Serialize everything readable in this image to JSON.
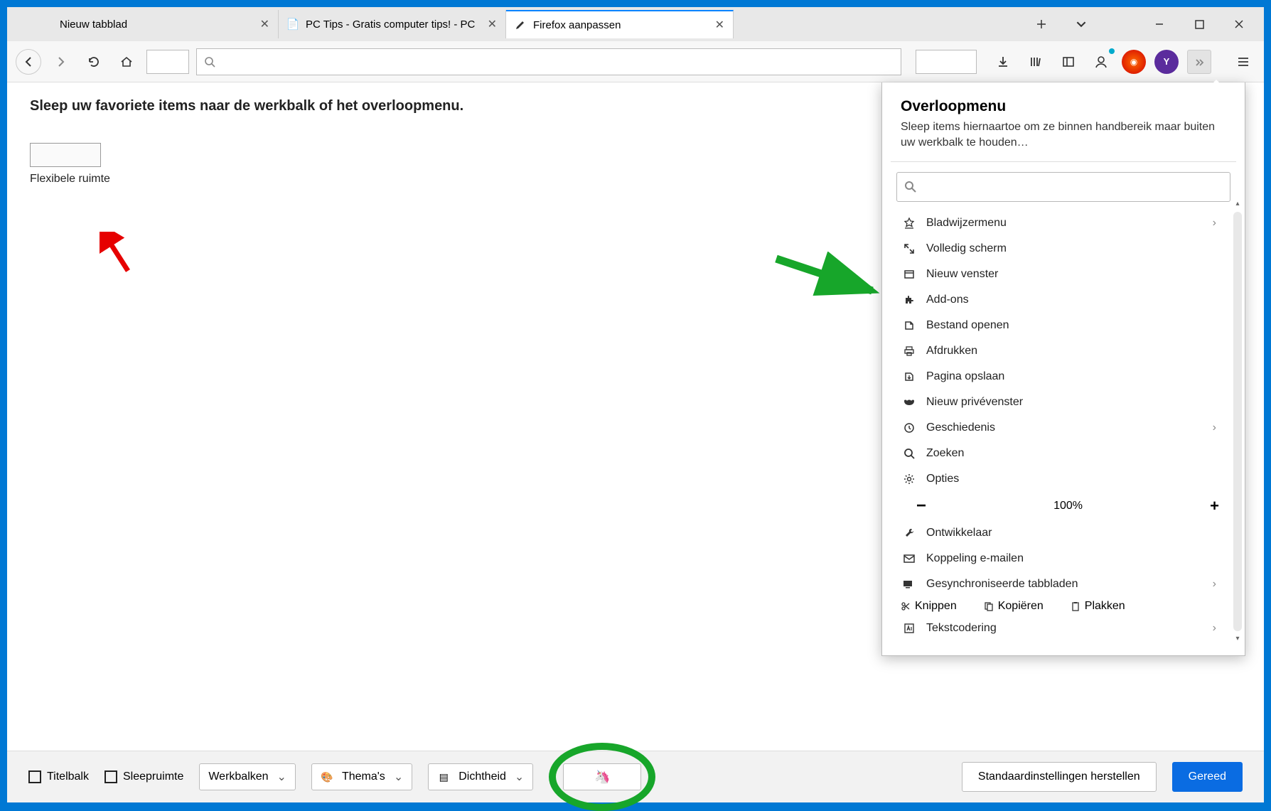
{
  "tabs": [
    {
      "label": "Nieuw tabblad",
      "active": false
    },
    {
      "label": "PC Tips - Gratis computer tips! - PC",
      "active": false
    },
    {
      "label": "Firefox aanpassen",
      "active": true
    }
  ],
  "content": {
    "heading": "Sleep uw favoriete items naar de werkbalk of het overloopmenu.",
    "flex_space_label": "Flexibele ruimte"
  },
  "overflow": {
    "title": "Overloopmenu",
    "desc": "Sleep items hiernaartoe om ze binnen handbereik maar buiten uw werkbalk te houden…",
    "items": [
      {
        "label": "Bladwijzermenu",
        "chev": true
      },
      {
        "label": "Volledig scherm"
      },
      {
        "label": "Nieuw venster"
      },
      {
        "label": "Add-ons"
      },
      {
        "label": "Bestand openen"
      },
      {
        "label": "Afdrukken"
      },
      {
        "label": "Pagina opslaan"
      },
      {
        "label": "Nieuw privévenster"
      },
      {
        "label": "Geschiedenis",
        "chev": true
      },
      {
        "label": "Zoeken"
      },
      {
        "label": "Opties"
      }
    ],
    "zoom": "100%",
    "items2": [
      {
        "label": "Ontwikkelaar"
      },
      {
        "label": "Koppeling e-mailen"
      },
      {
        "label": "Gesynchroniseerde tabbladen",
        "chev": true
      }
    ],
    "clip": {
      "cut": "Knippen",
      "copy": "Kopiëren",
      "paste": "Plakken"
    },
    "items3": [
      {
        "label": "Tekstcodering",
        "chev": true
      }
    ]
  },
  "footer": {
    "titlebar": "Titelbalk",
    "sleepruimte": "Sleepruimte",
    "werkbalken": "Werkbalken",
    "themas": "Thema's",
    "dichtheid": "Dichtheid",
    "restore": "Standaardinstellingen herstellen",
    "done": "Gereed"
  },
  "profile_letter": "Y"
}
